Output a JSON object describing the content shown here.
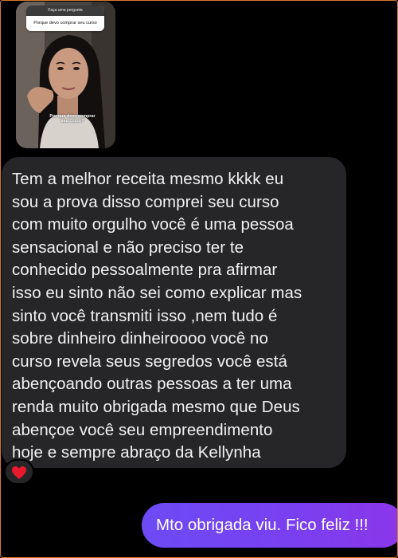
{
  "story_reply": {
    "question_header": "Faça uma pergunta",
    "question_text": "Porque devo comprar seu curso",
    "caption": "Por que devo comprar seu curso?"
  },
  "messages": {
    "received": {
      "text": "Tem a melhor receita mesmo kkkk eu\nsou a prova disso comprei seu curso\ncom muito orgulho você é uma pessoa\nsensacional e não preciso ter te\nconhecido pessoalmente pra afirmar\nisso eu sinto não sei como explicar mas\nsinto você transmiti isso ,nem tudo é\nsobre dinheiro dinheiroooo você no\ncurso revela seus segredos você está\nabençoando outras pessoas a ter uma\nrenda muito obrigada mesmo que Deus\nabençoe você seu empreendimento\nhoje e sempre abraço da Kellynha",
      "reaction_icon": "red-heart-icon"
    },
    "sent": {
      "text": "Mto obrigada viu. Fico feliz !!!"
    }
  },
  "colors": {
    "background": "#000000",
    "received_bubble": "#262629",
    "sent_bubble_start": "#6c4bf5",
    "sent_bubble_end": "#8b37e8",
    "reaction_heart": "#e8192c",
    "frame_border": "#d9792e"
  }
}
